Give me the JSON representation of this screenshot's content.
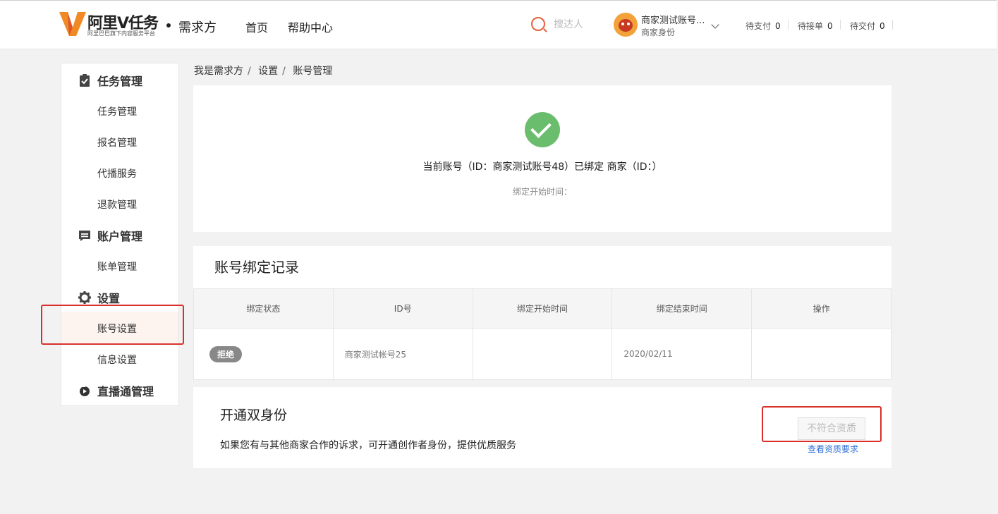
{
  "header": {
    "logo_text": "阿里V任务",
    "logo_sub": "阿里巴巴旗下内容服务平台",
    "role": "需求方",
    "nav": [
      "首页",
      "帮助中心"
    ],
    "search_placeholder": "搜达人",
    "user_name": "商家测试账号...",
    "user_role": "商家身份",
    "stats": [
      {
        "label": "待支付",
        "value": "0"
      },
      {
        "label": "待接单",
        "value": "0"
      },
      {
        "label": "待交付",
        "value": "0"
      }
    ]
  },
  "sidebar": {
    "groups": [
      {
        "label": "任务管理",
        "icon": "clipboard-icon",
        "items": [
          "任务管理",
          "报名管理",
          "代播服务",
          "退款管理"
        ]
      },
      {
        "label": "账户管理",
        "icon": "message-icon",
        "items": [
          "账单管理"
        ]
      },
      {
        "label": "设置",
        "icon": "gear-icon",
        "items": [
          "账号设置",
          "信息设置"
        ]
      },
      {
        "label": "直播通管理",
        "icon": "live-icon",
        "items": []
      }
    ],
    "active_item": "账号设置"
  },
  "breadcrumb": [
    "我是需求方",
    "设置",
    "账号管理"
  ],
  "bind_status": {
    "message": "当前账号（ID：商家测试账号48）已绑定 商家（ID：）",
    "start_time": "绑定开始时间："
  },
  "records": {
    "title": "账号绑定记录",
    "columns": [
      "绑定状态",
      "ID号",
      "绑定开始时间",
      "绑定结束时间",
      "操作"
    ],
    "rows": [
      {
        "status": "拒绝",
        "id": "商家测试帐号25",
        "start": "",
        "end": "2020/02/11",
        "action": ""
      }
    ]
  },
  "dual": {
    "title": "开通双身份",
    "description": "如果您有与其他商家合作的诉求，可开通创作者身份，提供优质服务",
    "button": "不符合资质",
    "link": "查看资质要求"
  },
  "colors": {
    "accent": "#e8603c",
    "success": "#6bbd6e",
    "highlight": "#d9302c",
    "link": "#2f6fd8"
  }
}
